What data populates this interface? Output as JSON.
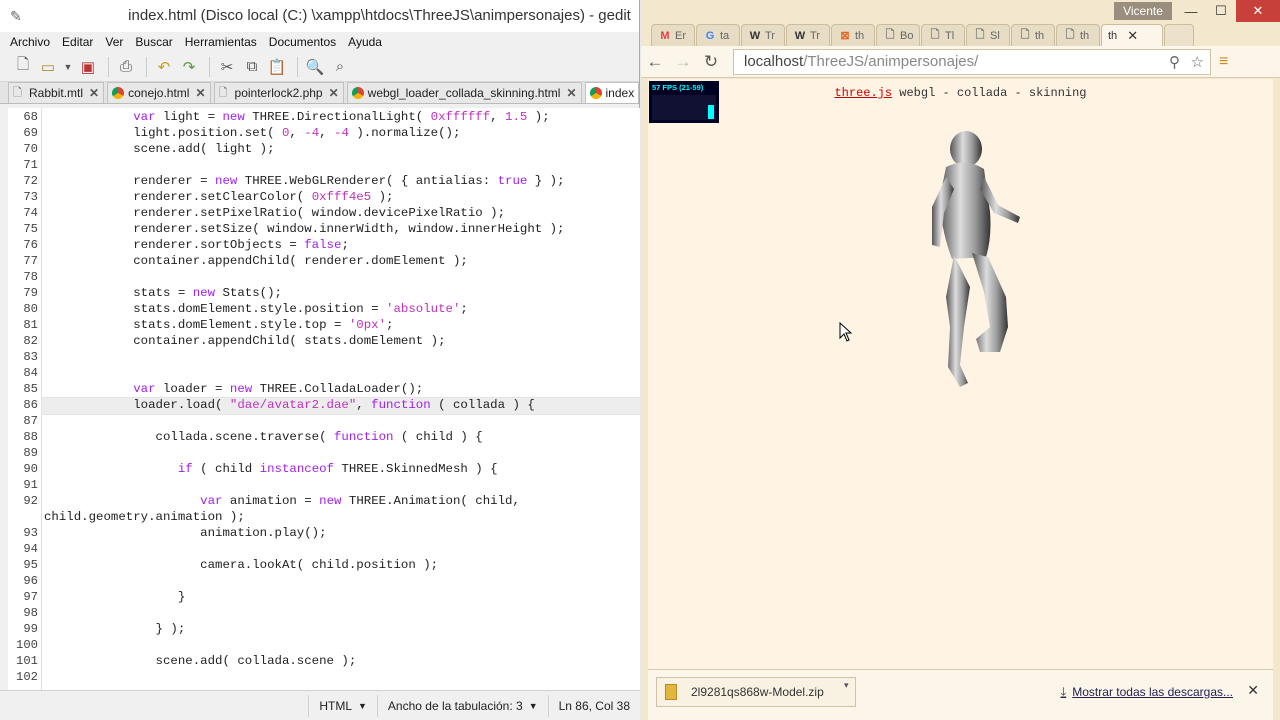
{
  "gedit": {
    "title": "index.html (Disco local (C:) \\xampp\\htdocs\\ThreeJS\\animpersonajes) - gedit",
    "menu": [
      "Archivo",
      "Editar",
      "Ver",
      "Buscar",
      "Herramientas",
      "Documentos",
      "Ayuda"
    ],
    "tabs": [
      {
        "label": "Rabbit.mtl",
        "icon": "file-icon"
      },
      {
        "label": "conejo.html",
        "icon": "chrome-icon"
      },
      {
        "label": "pointerlock2.php",
        "icon": "file-icon"
      },
      {
        "label": "webgl_loader_collada_skinning.html",
        "icon": "chrome-icon"
      },
      {
        "label": "index",
        "icon": "chrome-icon"
      }
    ],
    "lines": [
      {
        "n": "68",
        "html": "            <span class='kw'>var</span> light = <span class='kw'>new</span> THREE.DirectionalLight( <span class='nm'>0xffffff</span>, <span class='nm'>1.5</span> );"
      },
      {
        "n": "69",
        "html": "            light.position.set( <span class='nm'>0</span>, <span class='nm'>-4</span>, <span class='nm'>-4</span> ).normalize();"
      },
      {
        "n": "70",
        "html": "            scene.add( light );"
      },
      {
        "n": "71",
        "html": ""
      },
      {
        "n": "72",
        "html": "            renderer = <span class='kw'>new</span> THREE.WebGLRenderer( { antialias: <span class='kw'>true</span> } );"
      },
      {
        "n": "73",
        "html": "            renderer.setClearColor( <span class='nm'>0xfff4e5</span> );"
      },
      {
        "n": "74",
        "html": "            renderer.setPixelRatio( window.devicePixelRatio );"
      },
      {
        "n": "75",
        "html": "            renderer.setSize( window.innerWidth, window.innerHeight );"
      },
      {
        "n": "76",
        "html": "            renderer.sortObjects = <span class='kw'>false</span>;"
      },
      {
        "n": "77",
        "html": "            container.appendChild( renderer.domElement );"
      },
      {
        "n": "78",
        "html": ""
      },
      {
        "n": "79",
        "html": "            stats = <span class='kw'>new</span> Stats();"
      },
      {
        "n": "80",
        "html": "            stats.domElement.style.position = <span class='st'>'absolute'</span>;"
      },
      {
        "n": "81",
        "html": "            stats.domElement.style.top = <span class='st'>'0px'</span>;"
      },
      {
        "n": "82",
        "html": "            container.appendChild( stats.domElement );"
      },
      {
        "n": "83",
        "html": ""
      },
      {
        "n": "84",
        "html": ""
      },
      {
        "n": "85",
        "html": "            <span class='kw'>var</span> loader = <span class='kw'>new</span> THREE.ColladaLoader();"
      },
      {
        "n": "86",
        "html": "            loader.load( <span class='st'>\"dae/avatar2.dae\"</span>, <span class='kw'>function</span> ( collada ) {"
      },
      {
        "n": "87",
        "html": ""
      },
      {
        "n": "88",
        "html": "               collada.scene.traverse( <span class='kw'>function</span> ( child ) {"
      },
      {
        "n": "89",
        "html": ""
      },
      {
        "n": "90",
        "html": "                  <span class='kw'>if</span> ( child <span class='kw'>instanceof</span> THREE.SkinnedMesh ) {"
      },
      {
        "n": "91",
        "html": ""
      },
      {
        "n": "92",
        "html": "                     <span class='kw'>var</span> animation = <span class='kw'>new</span> THREE.Animation( child,"
      },
      {
        "n": "",
        "html": "child.geometry.animation );"
      },
      {
        "n": "93",
        "html": "                     animation.play();"
      },
      {
        "n": "94",
        "html": ""
      },
      {
        "n": "95",
        "html": "                     camera.lookAt( child.position );"
      },
      {
        "n": "96",
        "html": ""
      },
      {
        "n": "97",
        "html": "                  }"
      },
      {
        "n": "98",
        "html": ""
      },
      {
        "n": "99",
        "html": "               } );"
      },
      {
        "n": "100",
        "html": ""
      },
      {
        "n": "101",
        "html": "               scene.add( collada.scene );"
      },
      {
        "n": "102",
        "html": ""
      }
    ],
    "status": {
      "language": "HTML",
      "tab_width": "Ancho de la tabulación: 3",
      "position": "Ln 86, Col 38"
    }
  },
  "browser": {
    "user": "Vicente",
    "tabs": [
      {
        "label": "Er",
        "icon": "gmail-icon",
        "glyph": "M",
        "color": "#d44"
      },
      {
        "label": "ta",
        "icon": "google-icon",
        "glyph": "G",
        "color": "#4285f4"
      },
      {
        "label": "Tr",
        "icon": "wikipedia-icon",
        "glyph": "W",
        "color": "#333"
      },
      {
        "label": "Tr",
        "icon": "wikipedia-icon",
        "glyph": "W",
        "color": "#333"
      },
      {
        "label": "th",
        "icon": "orange-page-icon",
        "glyph": "⊠",
        "color": "#e8662a"
      },
      {
        "label": "Bo",
        "icon": "page-icon",
        "glyph": "🗋",
        "color": "#777"
      },
      {
        "label": "Tl",
        "icon": "page-icon",
        "glyph": "🗋",
        "color": "#777"
      },
      {
        "label": "Sl",
        "icon": "page-icon",
        "glyph": "🗋",
        "color": "#777"
      },
      {
        "label": "th",
        "icon": "page-icon",
        "glyph": "🗋",
        "color": "#777"
      },
      {
        "label": "th",
        "icon": "page-icon",
        "glyph": "🗋",
        "color": "#777"
      }
    ],
    "active_tab": "th",
    "url_host": "localhost",
    "url_path": "/ThreeJS/animpersonajes/",
    "page": {
      "fps": "57 FPS (21-59)",
      "info_link": "three.js",
      "info_text": " webgl - collada - skinning"
    },
    "download": {
      "file": "2l9281qs868w-Model.zip",
      "show_all": "Mostrar todas las descargas..."
    }
  }
}
